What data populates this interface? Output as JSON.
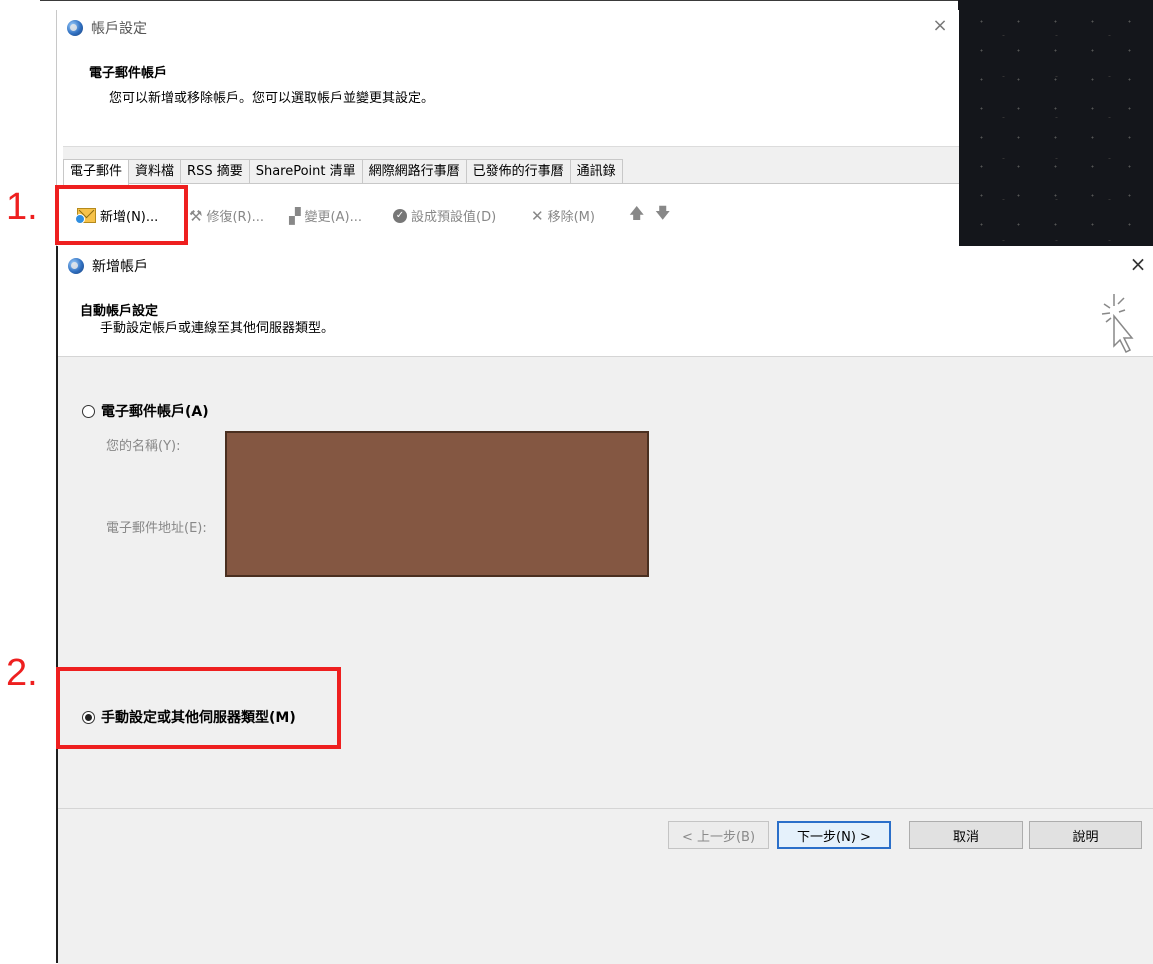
{
  "account_settings": {
    "title": "帳戶設定",
    "close_glyph": "×",
    "heading": "電子郵件帳戶",
    "description": "您可以新增或移除帳戶。您可以選取帳戶並變更其設定。",
    "tabs": [
      {
        "label": "電子郵件",
        "active": true
      },
      {
        "label": "資料檔",
        "active": false
      },
      {
        "label": "RSS 摘要",
        "active": false
      },
      {
        "label": "SharePoint 清單",
        "active": false
      },
      {
        "label": "網際網路行事曆",
        "active": false
      },
      {
        "label": "已發佈的行事曆",
        "active": false
      },
      {
        "label": "通訊錄",
        "active": false
      }
    ],
    "toolbar": {
      "new_label": "新增(N)...",
      "repair_label": "修復(R)...",
      "change_label": "變更(A)...",
      "default_label": "設成預設值(D)",
      "remove_label": "移除(M)",
      "up_glyph": "🡅",
      "down_glyph": "🡇"
    }
  },
  "add_account": {
    "title": "新增帳戶",
    "close_glyph": "×",
    "heading": "自動帳戶設定",
    "description": "手動設定帳戶或連線至其他伺服器類型。",
    "options": {
      "email_account": {
        "label": "電子郵件帳戶(A)",
        "selected": false
      },
      "manual_setup": {
        "label": "手動設定或其他伺服器類型(M)",
        "selected": true
      }
    },
    "fields": {
      "name_label": "您的名稱(Y):",
      "email_label": "電子郵件地址(E):"
    },
    "buttons": {
      "back": "< 上一步(B)",
      "next": "下一步(N) >",
      "cancel": "取消",
      "help": "說明"
    }
  },
  "annotations": {
    "step1": "1.",
    "step2": "2."
  },
  "colors": {
    "annotation_red": "#ee1f1f",
    "redaction": "#845742",
    "dialog_gray": "#f0f0f0"
  }
}
